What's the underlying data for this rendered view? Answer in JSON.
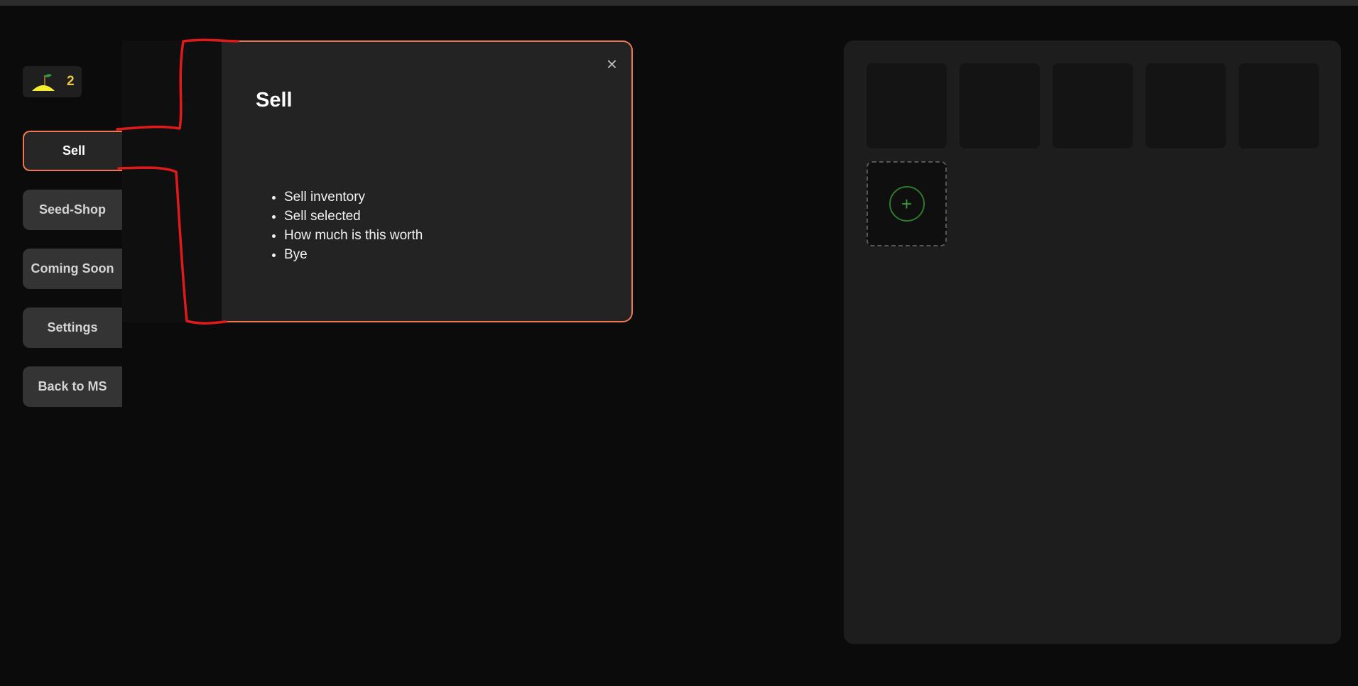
{
  "currency": {
    "icon": "seed-sprout-icon",
    "amount": "2",
    "color": "#f0c64a"
  },
  "sidebar": {
    "items": [
      {
        "label": "Sell",
        "active": true
      },
      {
        "label": "Seed-Shop",
        "active": false
      },
      {
        "label": "Coming Soon",
        "active": false
      },
      {
        "label": "Settings",
        "active": false
      },
      {
        "label": "Back to MS",
        "active": false
      }
    ]
  },
  "popup": {
    "title": "Sell",
    "close_icon": "close-icon",
    "close_glyph": "×",
    "options": [
      "Sell inventory",
      "Sell selected",
      "How much is this worth",
      "Bye"
    ],
    "accent": "#f07850"
  },
  "inventory": {
    "add_glyph": "+",
    "add_icon": "plus-circle-icon",
    "accent": "#2c7a2c"
  },
  "annotation": {
    "color": "#e01a1a"
  }
}
